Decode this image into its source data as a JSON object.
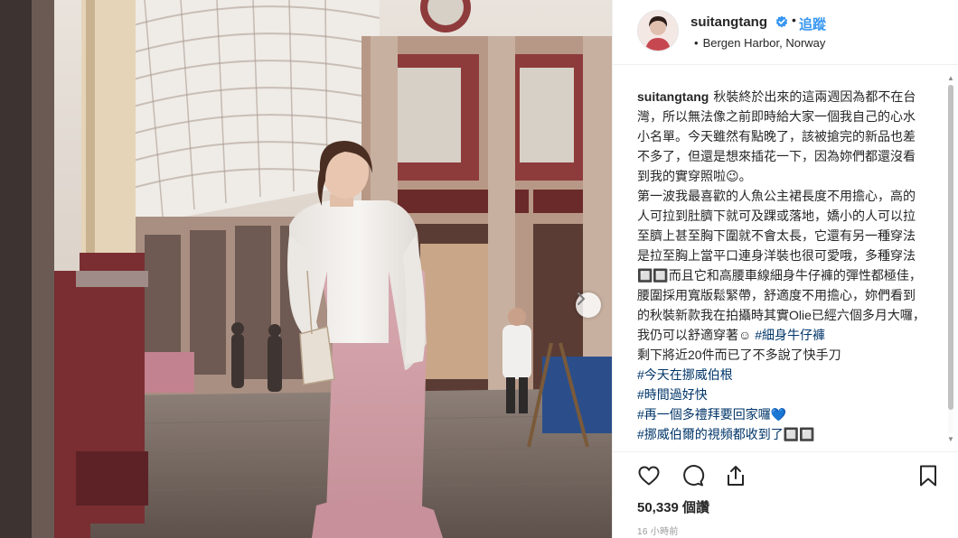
{
  "post": {
    "username": "suitangtang",
    "follow_label": "追蹤",
    "separator": "•",
    "location": "Bergen Harbor, Norway",
    "location_bullet": "•"
  },
  "caption": {
    "username": "suitangtang",
    "body_lines": [
      "秋裝終於出來的這兩週因為都不在台灣，所以無法像之前即時給大家一個我自己的心水小名單。今天雖然有點晚了，該被搶完的新品也差不多了，但還是想來插花一下，因為妳們都還沒看到我的實穿照啦😉。",
      "第一波我最喜歡的人魚公主裙長度不用擔心，高的人可拉到肚臍下就可及踝或落地，嬌小的人可以拉至臍上甚至胸下圍就不會太長，它還有另一種穿法是拉至胸上當平口連身洋裝也很可愛哦，多種穿法🔲🔲而且它和高腰車線細身牛仔褲的彈性都極佳，腰圍採用寬版鬆緊帶，舒適度不用擔心，妳們看到的秋裝新款我在拍攝時其實Olie已經六個多月大囉，我仍可以舒適穿著☺ "
    ],
    "inline_hashtag": "#細身牛仔褲",
    "after_hashtag": "剩下將近20件而已了不多說了快手刀",
    "hashtags": [
      "#今天在挪威伯根",
      "#時間過好快",
      "#再一個多禮拜要回家囉💙",
      "#挪威伯爾的視頻都收到了🔲🔲"
    ]
  },
  "actions": {
    "icons": [
      "heart-icon",
      "comment-icon",
      "share-icon",
      "bookmark-icon"
    ]
  },
  "likes": "50,339 個讚",
  "timestamp": "16 小時前",
  "colors": {
    "link_blue": "#3897f0",
    "hashtag": "#003569",
    "text": "#262626",
    "muted": "#999999"
  }
}
